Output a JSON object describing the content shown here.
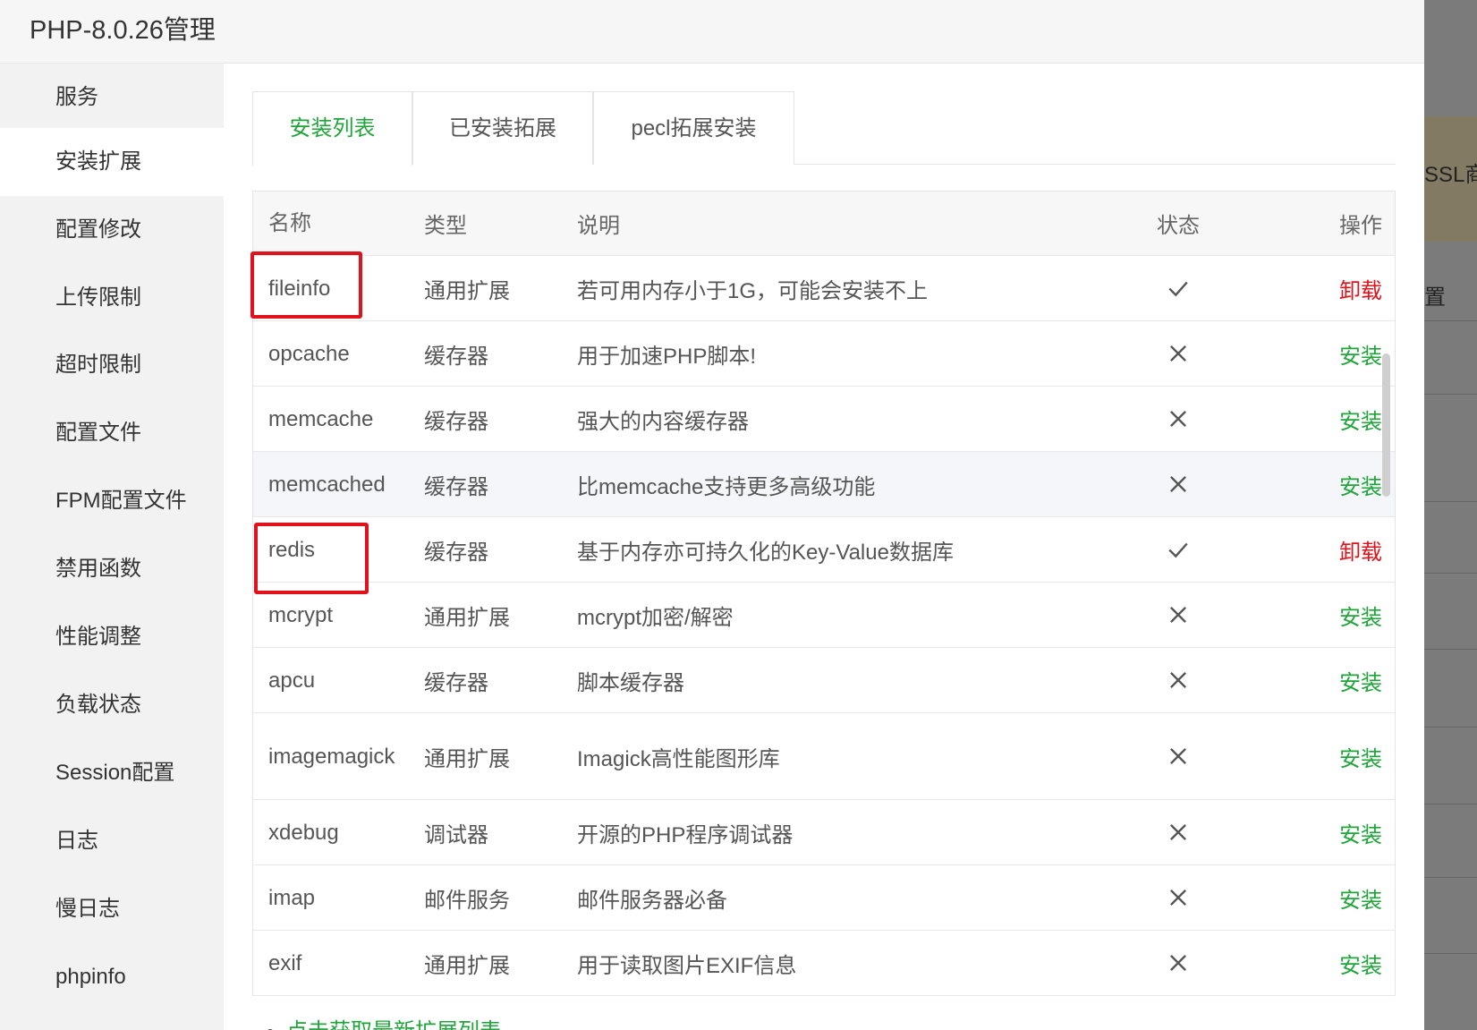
{
  "dialog": {
    "title": "PHP-8.0.26管理"
  },
  "background": {
    "fragment_1": "SSL商",
    "fragment_2": "置"
  },
  "sidebar": {
    "items": [
      {
        "label": "服务"
      },
      {
        "label": "安装扩展"
      },
      {
        "label": "配置修改"
      },
      {
        "label": "上传限制"
      },
      {
        "label": "超时限制"
      },
      {
        "label": "配置文件"
      },
      {
        "label": "FPM配置文件"
      },
      {
        "label": "禁用函数"
      },
      {
        "label": "性能调整"
      },
      {
        "label": "负载状态"
      },
      {
        "label": "Session配置"
      },
      {
        "label": "日志"
      },
      {
        "label": "慢日志"
      },
      {
        "label": "phpinfo"
      }
    ],
    "active_index": 1
  },
  "tabs": [
    {
      "label": "安装列表"
    },
    {
      "label": "已安装拓展"
    },
    {
      "label": "pecl拓展安装"
    }
  ],
  "table": {
    "headers": {
      "name": "名称",
      "type": "类型",
      "desc": "说明",
      "status": "状态",
      "op": "操作"
    },
    "rows": [
      {
        "name": "fileinfo",
        "type": "通用扩展",
        "desc": "若可用内存小于1G，可能会安装不上",
        "installed": true,
        "op": "卸载"
      },
      {
        "name": "opcache",
        "type": "缓存器",
        "desc": "用于加速PHP脚本!",
        "installed": false,
        "op": "安装"
      },
      {
        "name": "memcache",
        "type": "缓存器",
        "desc": "强大的内容缓存器",
        "installed": false,
        "op": "安装"
      },
      {
        "name": "memcached",
        "type": "缓存器",
        "desc": "比memcache支持更多高级功能",
        "installed": false,
        "op": "安装"
      },
      {
        "name": "redis",
        "type": "缓存器",
        "desc": "基于内存亦可持久化的Key-Value数据库",
        "installed": true,
        "op": "卸载"
      },
      {
        "name": "mcrypt",
        "type": "通用扩展",
        "desc": "mcrypt加密/解密",
        "installed": false,
        "op": "安装"
      },
      {
        "name": "apcu",
        "type": "缓存器",
        "desc": "脚本缓存器",
        "installed": false,
        "op": "安装"
      },
      {
        "name": "imagemagick",
        "type": "通用扩展",
        "desc": "Imagick高性能图形库",
        "installed": false,
        "op": "安装"
      },
      {
        "name": "xdebug",
        "type": "调试器",
        "desc": "开源的PHP程序调试器",
        "installed": false,
        "op": "安装"
      },
      {
        "name": "imap",
        "type": "邮件服务",
        "desc": "邮件服务器必备",
        "installed": false,
        "op": "安装"
      },
      {
        "name": "exif",
        "type": "通用扩展",
        "desc": "用于读取图片EXIF信息",
        "installed": false,
        "op": "安装"
      }
    ]
  },
  "footer": {
    "more_link": "点击获取最新扩展列表"
  },
  "colors": {
    "accent_green": "#20a53a",
    "danger_red": "#e0121b",
    "highlight_box": "#e0121b"
  },
  "icons": {
    "installed": "check-icon",
    "not_installed": "cross-icon",
    "close": "close-icon"
  }
}
